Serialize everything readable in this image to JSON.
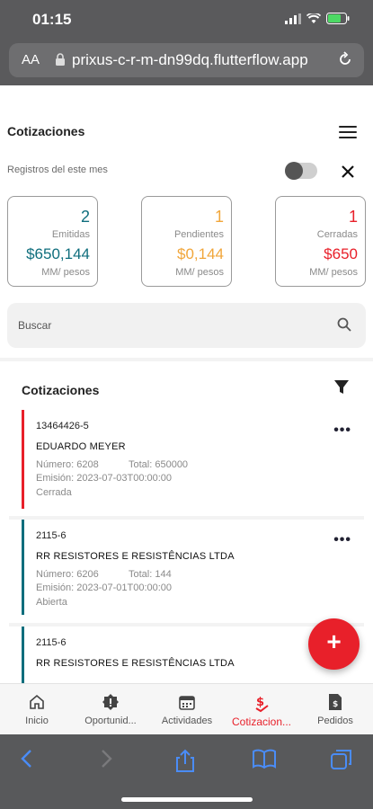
{
  "status_bar": {
    "time": "01:15"
  },
  "browser": {
    "aa_label": "AA",
    "url": "prixus-c-r-m-dn99dq.flutterflow.app"
  },
  "app": {
    "title": "Cotizaciones",
    "filter_label": "Registros del este mes"
  },
  "stats": [
    {
      "count": "2",
      "label": "Emitidas",
      "amount": "$650,144",
      "unit": "MM/ pesos",
      "color": "#0f6e7d"
    },
    {
      "count": "1",
      "label": "Pendientes",
      "amount": "$0,144",
      "unit": "MM/ pesos",
      "color": "#f1a63a"
    },
    {
      "count": "1",
      "label": "Cerradas",
      "amount": "$650",
      "unit": "MM/ pesos",
      "color": "#e8202a"
    }
  ],
  "search": {
    "placeholder": "Buscar"
  },
  "list": {
    "title": "Cotizaciones",
    "items": [
      {
        "code": "13464426-5",
        "client": "EDUARDO MEYER",
        "number": "Número: 6208",
        "total": "Total: 650000",
        "emision": "Emisión: 2023-07-03T00:00:00",
        "status": "Cerrada",
        "color": "#e8202a",
        "more": "•••"
      },
      {
        "code": "2115-6",
        "client": "RR RESISTORES E RESISTÊNCIAS LTDA",
        "number": "Número: 6206",
        "total": "Total: 144",
        "emision": "Emisión: 2023-07-01T00:00:00",
        "status": "Abierta",
        "color": "#0f6e7d",
        "more": "•••"
      },
      {
        "code": "2115-6",
        "client": "RR RESISTORES E RESISTÊNCIAS LTDA",
        "color": "#0f6e7d"
      }
    ]
  },
  "fab": {
    "label": "+"
  },
  "bottom_nav": [
    {
      "label": "Inicio",
      "icon": "home-icon",
      "active": false
    },
    {
      "label": "Oportunid...",
      "icon": "opportunity-icon",
      "active": false
    },
    {
      "label": "Actividades",
      "icon": "calendar-icon",
      "active": false
    },
    {
      "label": "Cotizacion...",
      "icon": "quote-icon",
      "active": true
    },
    {
      "label": "Pedidos",
      "icon": "document-icon",
      "active": false
    }
  ],
  "colors": {
    "accent_red": "#e8202a",
    "accent_teal": "#0f6e7d",
    "accent_orange": "#f1a63a",
    "safari_blue": "#4a8cf7"
  }
}
